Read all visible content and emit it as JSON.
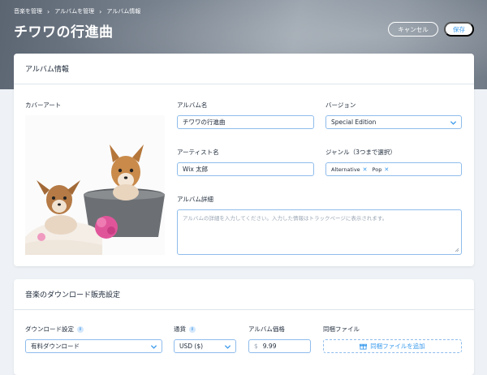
{
  "breadcrumb": {
    "items": [
      "音楽を管理",
      "アルバムを管理",
      "アルバム情報"
    ]
  },
  "header": {
    "title": "チワワの行進曲",
    "cancel_label": "キャンセル",
    "save_label": "保存"
  },
  "album_info": {
    "section_title": "アルバム情報",
    "cover_label": "カバーアート",
    "album_name_label": "アルバム名",
    "album_name_value": "チワワの行進曲",
    "version_label": "バージョン",
    "version_value": "Special Edition",
    "artist_label": "アーティスト名",
    "artist_value": "Wix 太郎",
    "genre_label": "ジャンル（3つまで選択）",
    "genres": [
      "Alternative",
      "Pop"
    ],
    "details_label": "アルバム詳細",
    "details_placeholder": "アルバムの詳細を入力してください。入力した情報はトラックページに表示されます。"
  },
  "download": {
    "section_title": "音楽のダウンロード販売設定",
    "download_setting_label": "ダウンロード設定",
    "download_setting_value": "有料ダウンロード",
    "currency_label": "通貨",
    "currency_value": "USD ($)",
    "price_label": "アルバム価格",
    "price_symbol": "$",
    "price_value": "9.99",
    "attachment_label": "同梱ファイル",
    "attachment_button": "同梱ファイルを追加"
  },
  "colors": {
    "accent": "#3899ec",
    "border": "#8fbcec",
    "text": "#1e2a3a"
  }
}
